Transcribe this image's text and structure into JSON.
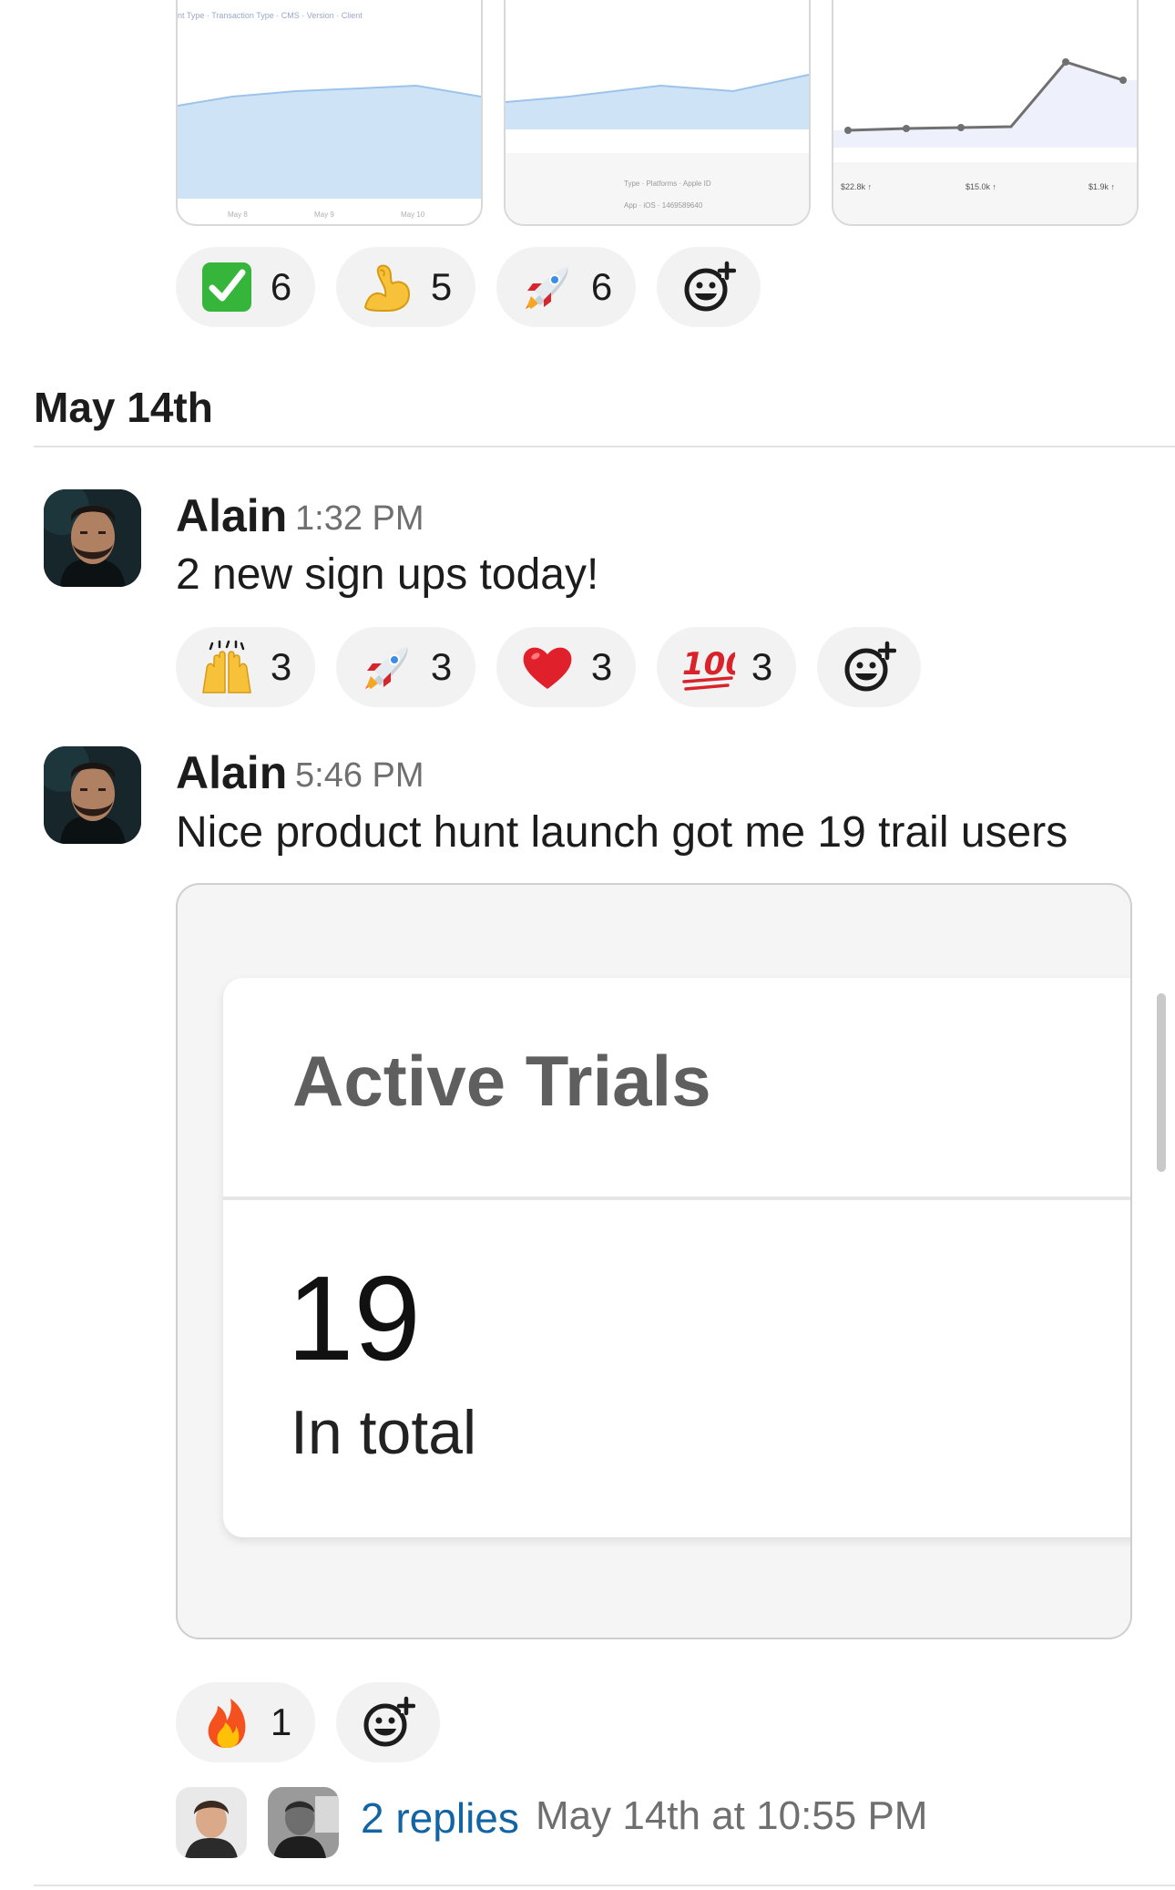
{
  "colors": {
    "link": "#1264a3",
    "muted_text": "#6f6f70",
    "reaction_bg": "#f2f2f2",
    "card_title": "#5f5f5f"
  },
  "prev_message": {
    "thumbnails": [
      "chart-thumbnail",
      "chart-thumbnail",
      "chart-thumbnail"
    ],
    "reactions": [
      {
        "icon": "check-mark-icon",
        "count": "6"
      },
      {
        "icon": "flexed-biceps-icon",
        "count": "5"
      },
      {
        "icon": "rocket-icon",
        "count": "6"
      }
    ],
    "add_reaction_icon": "add-reaction-icon"
  },
  "date_header": "May 14th",
  "messages": [
    {
      "author": "Alain",
      "time": "1:32 PM",
      "text": "2 new sign ups today!",
      "reactions": [
        {
          "icon": "raised-hands-icon",
          "count": "3"
        },
        {
          "icon": "rocket-icon",
          "count": "3"
        },
        {
          "icon": "red-heart-icon",
          "count": "3"
        },
        {
          "icon": "hundred-points-icon",
          "count": "3"
        }
      ]
    },
    {
      "author": "Alain",
      "time": "5:46 PM",
      "text": "Nice product hunt launch got me 19 trail users",
      "attachment": {
        "title": "Active Trials",
        "value": "19",
        "subtitle": "In total"
      },
      "reactions": [
        {
          "icon": "fire-icon",
          "count": "1"
        }
      ],
      "thread": {
        "replies": "2 replies",
        "last_reply": "May 14th at 10:55 PM"
      }
    }
  ]
}
